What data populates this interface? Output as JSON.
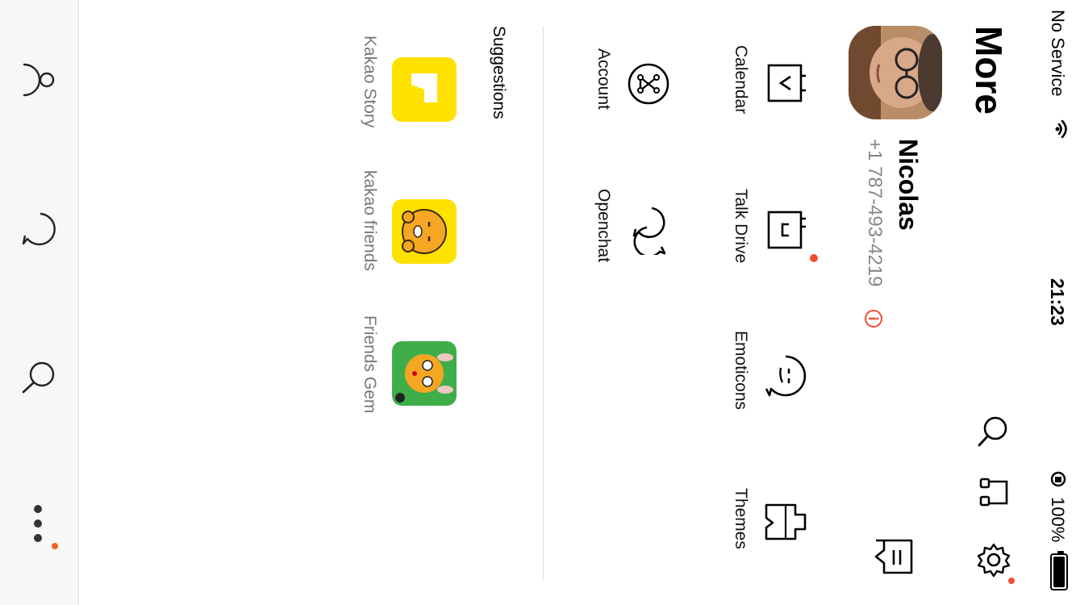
{
  "status_bar": {
    "carrier": "No Service",
    "time": "21:23",
    "battery": "100%"
  },
  "header": {
    "title": "More"
  },
  "profile": {
    "name": "Nicolas",
    "phone": "+1 787-493-4219"
  },
  "menu": {
    "row1": [
      "Calendar",
      "Talk Drive",
      "Emoticons",
      "Themes"
    ],
    "row2": [
      "Account",
      "Openchat"
    ]
  },
  "suggestions": {
    "title": "Suggestions",
    "apps": [
      "Kakao Story",
      "kakao friends",
      "Friends Gem"
    ]
  },
  "colors": {
    "kakao_yellow": "#FFE100",
    "badge_red": "#F04E30",
    "tab_dot": "#F26522"
  }
}
